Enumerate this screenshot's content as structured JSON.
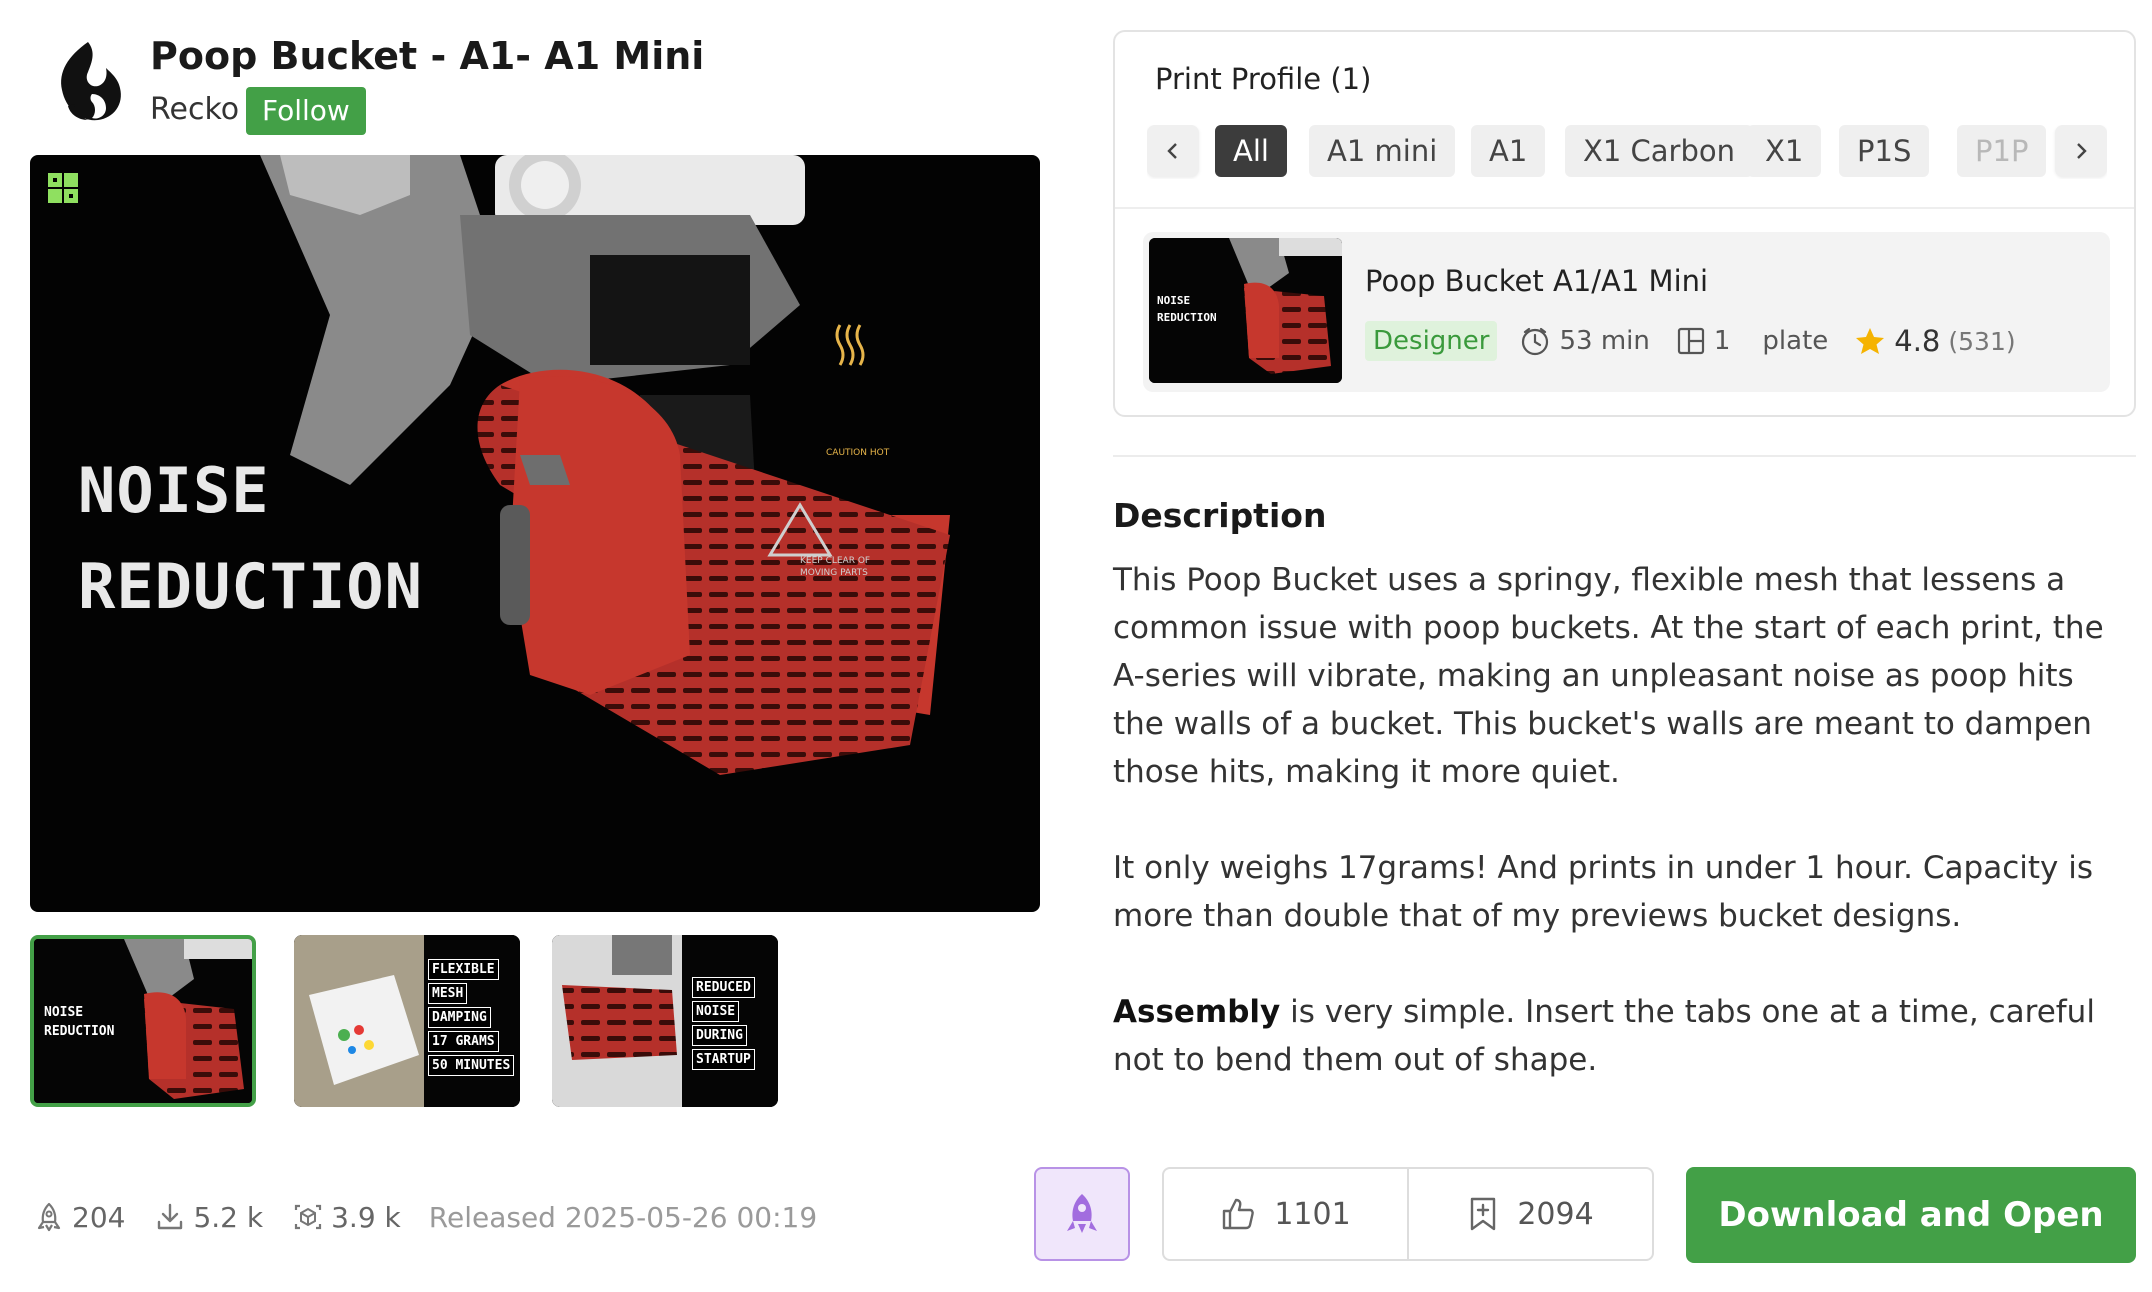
{
  "model": {
    "title": "Poop Bucket - A1- A1 Mini",
    "author": "Recko",
    "follow_label": "Follow"
  },
  "gallery": {
    "main_caption": [
      "NOISE",
      "REDUCTION"
    ],
    "printer_labels": [
      "CAUTION HOT",
      "KEEP CLEAR OF",
      "MOVING PARTS"
    ],
    "thumbnails": [
      {
        "caption": [
          "NOISE",
          "REDUCTION"
        ],
        "selected": true
      },
      {
        "caption": [
          "FLEXIBLE",
          "MESH",
          "DAMPING",
          "17 GRAMS",
          "50 MINUTES"
        ],
        "selected": false
      },
      {
        "caption": [
          "REDUCED",
          "NOISE",
          "DURING",
          "STARTUP"
        ],
        "selected": false
      }
    ]
  },
  "stats": {
    "boosts": "204",
    "downloads": "5.2 k",
    "prints": "3.9 k",
    "released": "Released 2025-05-26 00:19"
  },
  "print_profile": {
    "title": "Print Profile (1)",
    "filters": [
      "All",
      "A1 mini",
      "A1",
      "X1 Carbon",
      "X1",
      "P1S",
      "P1P"
    ],
    "active_filter": "All",
    "item": {
      "name": "Poop Bucket A1/A1 Mini",
      "thumb_caption": [
        "NOISE",
        "REDUCTION"
      ],
      "badge": "Designer",
      "time": "53 min",
      "plates_count": "1",
      "plates_label": "plate",
      "rating": "4.8",
      "rating_count": "(531)"
    }
  },
  "description": {
    "heading": "Description",
    "p1": "This Poop Bucket uses a springy, flexible mesh that lessens a common issue with poop buckets. At the start of each print, the A-series will vibrate, making an unpleasant noise as poop hits the walls of a bucket. This bucket's walls are meant to dampen those hits, making it more quiet.",
    "p2": "It only weighs 17grams! And prints in under 1 hour. Capacity is more than double that of my previews bucket designs.",
    "p3_bold": "Assembly",
    "p3_rest": " is very simple. Insert the tabs one at a time, careful not to bend them out of shape."
  },
  "actions": {
    "likes": "1101",
    "collections": "2094",
    "download_label": "Download and Open"
  },
  "colors": {
    "accent_green": "#43a047",
    "boost_purple": "#a26ddf",
    "star": "#f5b301",
    "bucket_red": "#c6372d"
  },
  "icons": {
    "brand": "bambu-logo",
    "boost": "rocket-icon",
    "like": "thumbs-up-icon",
    "collect": "bookmark-plus-icon"
  }
}
